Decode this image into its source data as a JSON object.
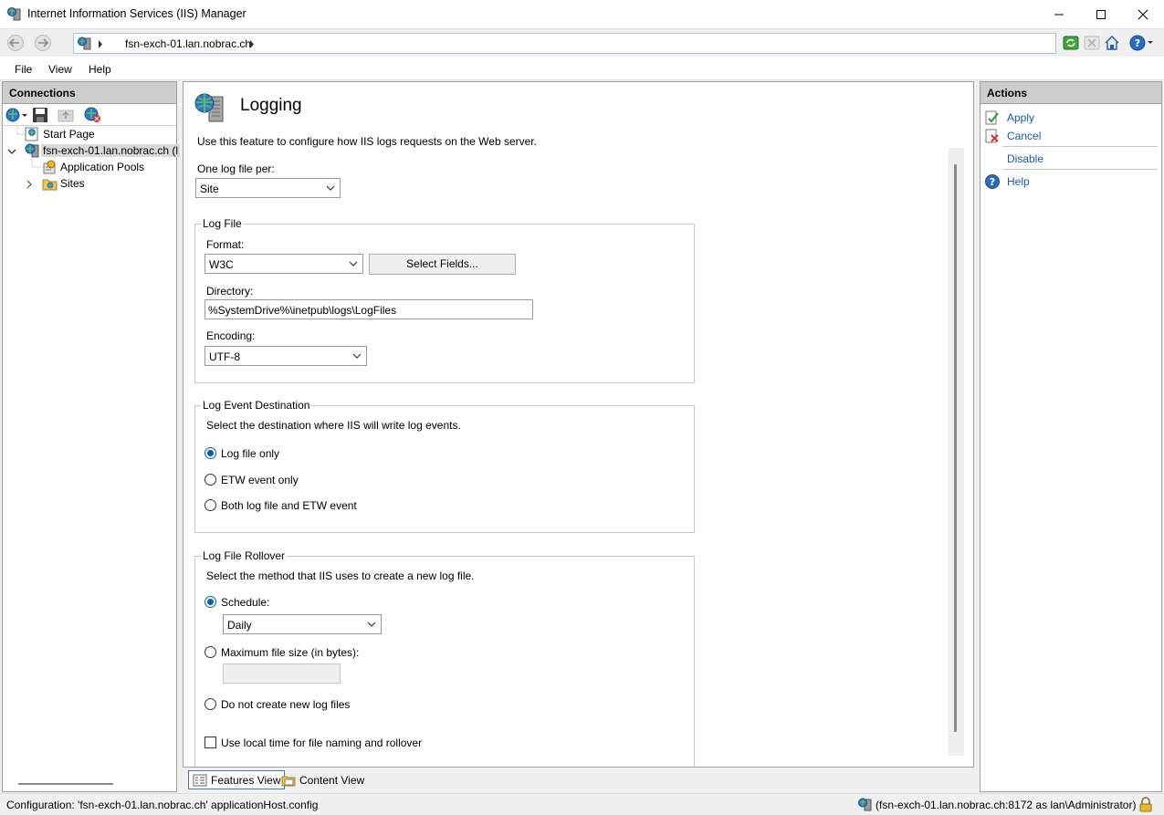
{
  "window": {
    "title": "Internet Information Services (IIS) Manager"
  },
  "address": {
    "breadcrumb": "fsn-exch-01.lan.nobrac.ch"
  },
  "menu": {
    "file": "File",
    "view": "View",
    "help": "Help"
  },
  "connections": {
    "header": "Connections",
    "tree": [
      {
        "label": "Start Page"
      },
      {
        "label": "fsn-exch-01.lan.nobrac.ch (l"
      },
      {
        "label": "Application Pools"
      },
      {
        "label": "Sites"
      }
    ]
  },
  "feature": {
    "title": "Logging",
    "description": "Use this feature to configure how IIS logs requests on the Web server.",
    "one_log_label": "One log file per:",
    "one_log_value": "Site",
    "log_file": {
      "legend": "Log File",
      "format_label": "Format:",
      "format_value": "W3C",
      "select_fields": "Select Fields...",
      "directory_label": "Directory:",
      "directory_value": "%SystemDrive%\\inetpub\\logs\\LogFiles",
      "encoding_label": "Encoding:",
      "encoding_value": "UTF-8"
    },
    "event_destination": {
      "legend": "Log Event Destination",
      "description": "Select the destination where IIS will write log events.",
      "options": [
        "Log file only",
        "ETW event only",
        "Both log file and ETW event"
      ],
      "selected_index": 0
    },
    "rollover": {
      "legend": "Log File Rollover",
      "description": "Select the method that IIS uses to create a new log file.",
      "schedule_label": "Schedule:",
      "schedule_value": "Daily",
      "max_size_label": "Maximum file size (in bytes):",
      "max_size_value": "",
      "no_new_label": "Do not create new log files",
      "selected": "schedule",
      "local_time_label": "Use local time for file naming and rollover",
      "local_time_checked": false
    }
  },
  "tabs": {
    "features": "Features View",
    "content": "Content View",
    "active": "features"
  },
  "actions": {
    "header": "Actions",
    "apply": "Apply",
    "cancel": "Cancel",
    "disable": "Disable",
    "help": "Help"
  },
  "status": {
    "left": "Configuration: 'fsn-exch-01.lan.nobrac.ch' applicationHost.config",
    "right": "(fsn-exch-01.lan.nobrac.ch:8172 as lan\\Administrator)"
  },
  "colors": {
    "accent": "#0063b1",
    "link": "#1a5aa8",
    "pane_header": "#cdcdcd"
  }
}
